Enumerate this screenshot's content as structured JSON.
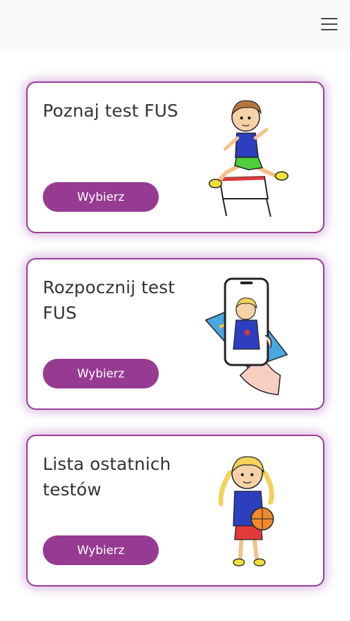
{
  "header": {
    "menu_icon": "hamburger-menu-icon"
  },
  "cards": [
    {
      "title": "Poznaj test FUS",
      "button_label": "Wybierz",
      "illustration": "boy-jumping-hurdle"
    },
    {
      "title": "Rozpocznij test FUS",
      "button_label": "Wybierz",
      "illustration": "hand-holding-phone"
    },
    {
      "title": "Lista ostatnich testów",
      "button_label": "Wybierz",
      "illustration": "girl-with-basketball"
    }
  ],
  "colors": {
    "accent": "#963b91",
    "card_border": "#9a3d96",
    "title_text": "#333333",
    "button_text": "#ffffff"
  }
}
